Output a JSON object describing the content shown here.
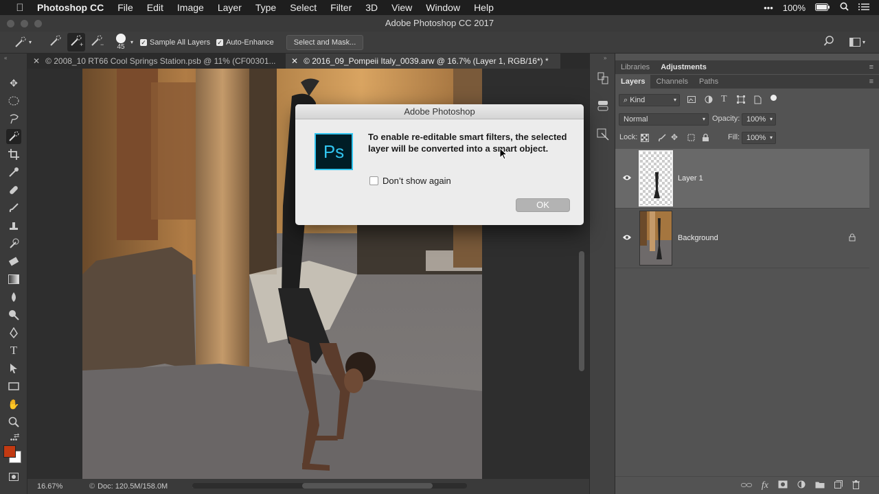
{
  "menubar": {
    "app_name": "Photoshop CC",
    "items": [
      "File",
      "Edit",
      "Image",
      "Layer",
      "Type",
      "Select",
      "Filter",
      "3D",
      "View",
      "Window",
      "Help"
    ],
    "battery": "100%"
  },
  "window": {
    "title": "Adobe Photoshop CC 2017"
  },
  "options": {
    "brush_size": "45",
    "sample_all_layers": "Sample All Layers",
    "auto_enhance": "Auto-Enhance",
    "select_and_mask": "Select and Mask..."
  },
  "tabs": [
    {
      "label": "© 2008_10 RT66 Cool Springs Station.psb @ 11% (CF00301..."
    },
    {
      "label": "© 2016_09_Pompeii Italy_0039.arw @ 16.7% (Layer 1, RGB/16*) *"
    }
  ],
  "status": {
    "zoom": "16.67%",
    "doc": "Doc: 120.5M/158.0M"
  },
  "panels": {
    "top_tabs": [
      "Libraries",
      "Adjustments"
    ],
    "layer_tabs": [
      "Layers",
      "Channels",
      "Paths"
    ],
    "filter_kind": "Kind",
    "blend_mode": "Normal",
    "opacity_label": "Opacity:",
    "opacity_value": "100%",
    "lock_label": "Lock:",
    "fill_label": "Fill:",
    "fill_value": "100%",
    "layers": [
      {
        "name": "Layer 1"
      },
      {
        "name": "Background"
      }
    ]
  },
  "dialog": {
    "title": "Adobe Photoshop",
    "message": "To enable re-editable smart filters, the selected layer will be converted into a smart object.",
    "checkbox_label": "Don’t show again",
    "ok_label": "OK",
    "logo_text": "Ps"
  },
  "colors": {
    "foreground": "#c23a12",
    "background": "#ffffff",
    "ps_blue": "#31c5f0"
  }
}
